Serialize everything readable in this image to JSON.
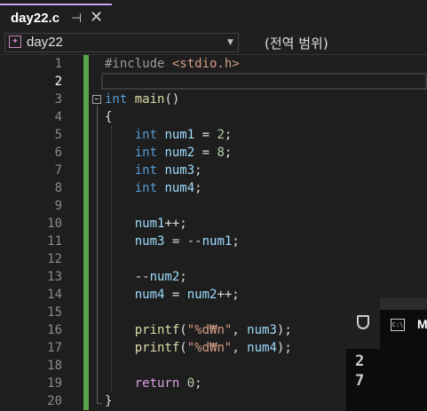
{
  "tab": {
    "title": "day22.c",
    "pin_glyph": "⊣",
    "close_glyph": "✕"
  },
  "navbar": {
    "project": "day22",
    "scope": "(전역 범위)"
  },
  "line_numbers": [
    "1",
    "2",
    "3",
    "4",
    "5",
    "6",
    "7",
    "8",
    "9",
    "10",
    "11",
    "12",
    "13",
    "14",
    "15",
    "16",
    "17",
    "18",
    "19",
    "20"
  ],
  "code": [
    [
      {
        "t": "#include ",
        "c": "pp"
      },
      {
        "t": "<stdio.h>",
        "c": "str"
      }
    ],
    [],
    [
      {
        "t": "int ",
        "c": "kw"
      },
      {
        "t": "main",
        "c": "fn"
      },
      {
        "t": "()",
        "c": ""
      }
    ],
    [
      {
        "t": "{",
        "c": ""
      }
    ],
    [
      {
        "t": "    int ",
        "c": "kw"
      },
      {
        "t": "num1",
        "c": "var"
      },
      {
        "t": " = ",
        "c": ""
      },
      {
        "t": "2",
        "c": "num"
      },
      {
        "t": ";",
        "c": ""
      }
    ],
    [
      {
        "t": "    int ",
        "c": "kw"
      },
      {
        "t": "num2",
        "c": "var"
      },
      {
        "t": " = ",
        "c": ""
      },
      {
        "t": "8",
        "c": "num"
      },
      {
        "t": ";",
        "c": ""
      }
    ],
    [
      {
        "t": "    int ",
        "c": "kw"
      },
      {
        "t": "num3",
        "c": "var"
      },
      {
        "t": ";",
        "c": ""
      }
    ],
    [
      {
        "t": "    int ",
        "c": "kw"
      },
      {
        "t": "num4",
        "c": "var"
      },
      {
        "t": ";",
        "c": ""
      }
    ],
    [],
    [
      {
        "t": "    num1",
        "c": "var"
      },
      {
        "t": "++;",
        "c": ""
      }
    ],
    [
      {
        "t": "    num3",
        "c": "var"
      },
      {
        "t": " = --",
        "c": ""
      },
      {
        "t": "num1",
        "c": "var"
      },
      {
        "t": ";",
        "c": ""
      }
    ],
    [],
    [
      {
        "t": "    --",
        "c": ""
      },
      {
        "t": "num2",
        "c": "var"
      },
      {
        "t": ";",
        "c": ""
      }
    ],
    [
      {
        "t": "    num4",
        "c": "var"
      },
      {
        "t": " = ",
        "c": ""
      },
      {
        "t": "num2",
        "c": "var"
      },
      {
        "t": "++;",
        "c": ""
      }
    ],
    [],
    [
      {
        "t": "    printf",
        "c": "fn"
      },
      {
        "t": "(",
        "c": ""
      },
      {
        "t": "\"%d₩n\"",
        "c": "str"
      },
      {
        "t": ", ",
        "c": ""
      },
      {
        "t": "num3",
        "c": "var"
      },
      {
        "t": ");",
        "c": ""
      }
    ],
    [
      {
        "t": "    printf",
        "c": "fn"
      },
      {
        "t": "(",
        "c": ""
      },
      {
        "t": "\"%d₩n\"",
        "c": "str"
      },
      {
        "t": ", ",
        "c": ""
      },
      {
        "t": "num4",
        "c": "var"
      },
      {
        "t": ");",
        "c": ""
      }
    ],
    [],
    [
      {
        "t": "    return ",
        "c": "ctrl"
      },
      {
        "t": "0",
        "c": "num"
      },
      {
        "t": ";",
        "c": ""
      }
    ],
    [
      {
        "t": "}",
        "c": ""
      }
    ]
  ],
  "console": {
    "title": "M",
    "cmd_icon_text": "C:\\",
    "output": [
      "2",
      "7"
    ]
  },
  "colors": {
    "accent": "#c8a2f0",
    "change_bar": "#57a64a",
    "keyword": "#569cd6",
    "string": "#d69d85"
  },
  "icons": {
    "pin": "pin-icon",
    "close": "close-icon",
    "project": "project-icon",
    "dropdown": "chevron-down-icon",
    "shield": "shield-icon",
    "terminal": "terminal-icon"
  }
}
